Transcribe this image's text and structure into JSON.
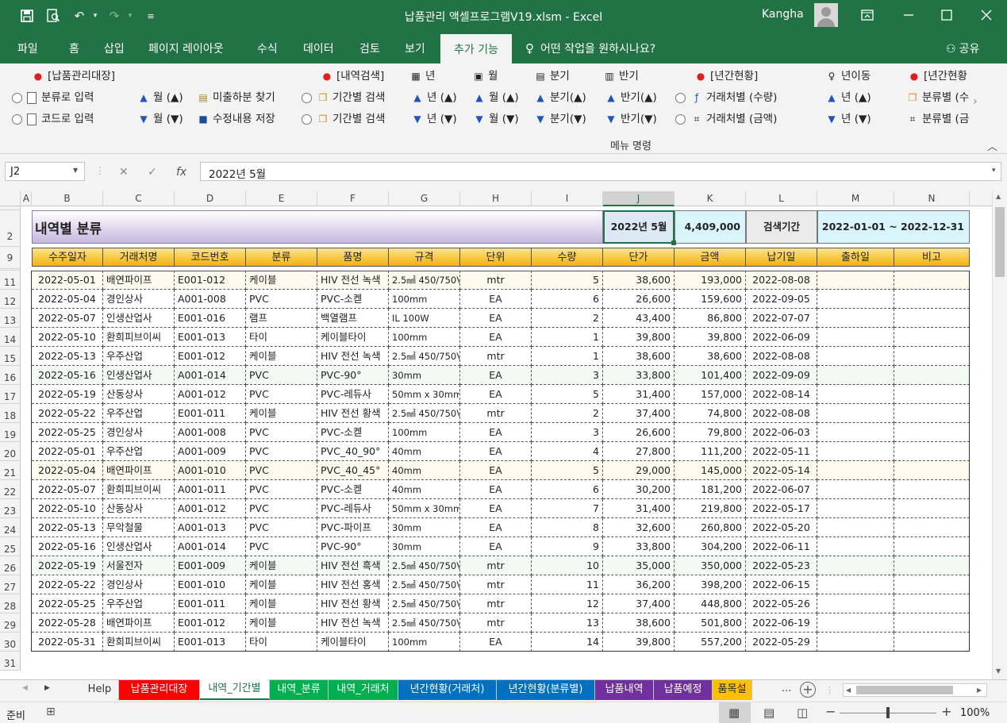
{
  "window": {
    "title": "납품관리 액셀프로그램V19.xlsm  -  Excel",
    "user": "Kangha"
  },
  "ribbon_tabs": [
    "파일",
    "홈",
    "삽입",
    "페이지 레이아웃",
    "수식",
    "데이터",
    "검토",
    "보기"
  ],
  "active_tab": "추가 기능",
  "tell_me": "어떤 작업을 원하시나요?",
  "share": "공유",
  "ribbon": {
    "group_label": "메뉴 명령",
    "headers": {
      "h1": "[납품관리대장]",
      "h2": "[내역검색]",
      "h3": "년",
      "h4": "월",
      "h5": "분기",
      "h6": "반기",
      "h7": "[년간현황]",
      "h8": "년이동",
      "h9": "[년간현황"
    },
    "items": {
      "r1": "분류로 입력",
      "r2": "코드로 입력",
      "m1": "월 (▲)",
      "m2": "월 (▼)",
      "f1": "미출하분 찾기",
      "f2": "수정내용 저장",
      "p1": "기간별 검색",
      "p2": "기간별 검색",
      "y1": "년 (▲)",
      "y2": "년 (▼)",
      "mo1": "월 (▲)",
      "mo2": "월 (▼)",
      "q1": "분기(▲)",
      "q2": "분기(▼)",
      "hy1": "반기(▲)",
      "hy2": "반기(▼)",
      "c1": "거래처별 (수량)",
      "c2": "거래처별 (금액)",
      "ym1": "년 (▲)",
      "ym2": "년 (▼)",
      "cl1": "분류별 (수",
      "cl2": "분류별 (금"
    }
  },
  "formula_bar": {
    "name_box": "J2",
    "formula": "2022년 5월"
  },
  "column_headers": [
    "A",
    "B",
    "C",
    "D",
    "E",
    "F",
    "G",
    "H",
    "I",
    "J",
    "K",
    "L",
    "M",
    "N"
  ],
  "sheet": {
    "title": "내역별 분류",
    "period": "2022년 5월",
    "total": "4,409,000",
    "search_label": "검색기간",
    "range": "2022-01-01 ~ 2022-12-31"
  },
  "table_headers": [
    "수주일자",
    "거래처명",
    "코드번호",
    "분류",
    "품명",
    "규격",
    "단위",
    "수량",
    "단가",
    "금액",
    "납기일",
    "출하일",
    "비고"
  ],
  "row_numbers": [
    "11",
    "12",
    "13",
    "14",
    "15",
    "16",
    "17",
    "18",
    "19",
    "20",
    "21",
    "22",
    "23",
    "24",
    "25",
    "26",
    "27",
    "28",
    "29",
    "30",
    "31"
  ],
  "rows": [
    [
      "2022-05-01",
      "배연파이프",
      "E001-012",
      "케이블",
      "HIV  전선 녹색",
      "2.5㎟ 450/750V",
      "mtr",
      "5",
      "38,600",
      "193,000",
      "2022-08-08",
      "",
      ""
    ],
    [
      "2022-05-04",
      "경인상사",
      "A001-008",
      "PVC",
      "PVC-소켇",
      "100mm",
      "EA",
      "6",
      "26,600",
      "159,600",
      "2022-09-05",
      "",
      ""
    ],
    [
      "2022-05-07",
      "인생산업사",
      "E001-016",
      "램프",
      "백열램프",
      "IL 100W",
      "EA",
      "2",
      "43,400",
      "86,800",
      "2022-07-07",
      "",
      ""
    ],
    [
      "2022-05-10",
      "환희피브이씨",
      "E001-013",
      "타이",
      "케이블타이",
      "100mm",
      "EA",
      "1",
      "39,800",
      "39,800",
      "2022-06-09",
      "",
      ""
    ],
    [
      "2022-05-13",
      "우주산업",
      "E001-012",
      "케이블",
      "HIV  전선 녹색",
      "2.5㎟ 450/750V",
      "mtr",
      "1",
      "38,600",
      "38,600",
      "2022-08-08",
      "",
      ""
    ],
    [
      "2022-05-16",
      "인생산업사",
      "A001-014",
      "PVC",
      "PVC-90°",
      "30mm",
      "EA",
      "3",
      "33,800",
      "101,400",
      "2022-09-09",
      "",
      ""
    ],
    [
      "2022-05-19",
      "산동상사",
      "A001-012",
      "PVC",
      "PVC-레듀사",
      "50mm x 30mm",
      "EA",
      "5",
      "31,400",
      "157,000",
      "2022-08-14",
      "",
      ""
    ],
    [
      "2022-05-22",
      "우주산업",
      "E001-011",
      "케이블",
      "HIV  전선 황색",
      "2.5㎟ 450/750V",
      "mtr",
      "2",
      "37,400",
      "74,800",
      "2022-08-08",
      "",
      ""
    ],
    [
      "2022-05-25",
      "경인상사",
      "A001-008",
      "PVC",
      "PVC-소켇",
      "100mm",
      "EA",
      "3",
      "26,600",
      "79,800",
      "2022-06-03",
      "",
      ""
    ],
    [
      "2022-05-01",
      "우주산업",
      "A001-009",
      "PVC",
      "PVC_40_90°",
      "40mm",
      "EA",
      "4",
      "27,800",
      "111,200",
      "2022-05-11",
      "",
      ""
    ],
    [
      "2022-05-04",
      "배연파이프",
      "A001-010",
      "PVC",
      "PVC_40_45°",
      "40mm",
      "EA",
      "5",
      "29,000",
      "145,000",
      "2022-05-14",
      "",
      ""
    ],
    [
      "2022-05-07",
      "환희피브이씨",
      "A001-011",
      "PVC",
      "PVC-소켇",
      "40mm",
      "EA",
      "6",
      "30,200",
      "181,200",
      "2022-06-07",
      "",
      ""
    ],
    [
      "2022-05-10",
      "산동상사",
      "A001-012",
      "PVC",
      "PVC-레듀사",
      "50mm x 30mm",
      "EA",
      "7",
      "31,400",
      "219,800",
      "2022-05-17",
      "",
      ""
    ],
    [
      "2022-05-13",
      "무악철물",
      "A001-013",
      "PVC",
      "PVC-파이프",
      "30mm",
      "EA",
      "8",
      "32,600",
      "260,800",
      "2022-05-20",
      "",
      ""
    ],
    [
      "2022-05-16",
      "인생산업사",
      "A001-014",
      "PVC",
      "PVC-90°",
      "30mm",
      "EA",
      "9",
      "33,800",
      "304,200",
      "2022-06-11",
      "",
      ""
    ],
    [
      "2022-05-19",
      "서울전자",
      "E001-009",
      "케이블",
      "HIV  전선 흑색",
      "2.5㎟ 450/750V",
      "mtr",
      "10",
      "35,000",
      "350,000",
      "2022-05-23",
      "",
      ""
    ],
    [
      "2022-05-22",
      "경인상사",
      "E001-010",
      "케이블",
      "HIV  전선 홍색",
      "2.5㎟ 450/750V",
      "mtr",
      "11",
      "36,200",
      "398,200",
      "2022-06-15",
      "",
      ""
    ],
    [
      "2022-05-25",
      "우주산업",
      "E001-011",
      "케이블",
      "HIV  전선 황색",
      "2.5㎟ 450/750V",
      "mtr",
      "12",
      "37,400",
      "448,800",
      "2022-05-26",
      "",
      ""
    ],
    [
      "2022-05-28",
      "배연파이프",
      "E001-012",
      "케이블",
      "HIV  전선 녹색",
      "2.5㎟ 450/750V",
      "mtr",
      "13",
      "38,600",
      "501,800",
      "2022-06-19",
      "",
      ""
    ],
    [
      "2022-05-31",
      "환희피브이씨",
      "E001-013",
      "타이",
      "케이블타이",
      "100mm",
      "EA",
      "14",
      "39,800",
      "557,200",
      "2022-05-29",
      "",
      ""
    ]
  ],
  "sheet_tabs": [
    {
      "label": "Help",
      "bg": "#f3f3f3",
      "fg": "#333"
    },
    {
      "label": "납품관리대장",
      "bg": "#ff0000",
      "fg": "#ffffff"
    },
    {
      "label": "내역_기간별",
      "bg": "#ffffff",
      "fg": "#217346"
    },
    {
      "label": "내역_분류",
      "bg": "#00b050",
      "fg": "#ffffff"
    },
    {
      "label": "내역_거래처",
      "bg": "#00b050",
      "fg": "#ffffff"
    },
    {
      "label": "년간현황(거래처)",
      "bg": "#0070c0",
      "fg": "#ffffff"
    },
    {
      "label": "년간현황(분류별)",
      "bg": "#0070c0",
      "fg": "#ffffff"
    },
    {
      "label": "납품내역",
      "bg": "#7030a0",
      "fg": "#ffffff"
    },
    {
      "label": "납품예정",
      "bg": "#7030a0",
      "fg": "#ffffff"
    },
    {
      "label": "품목설",
      "bg": "#ffc000",
      "fg": "#222222"
    }
  ],
  "tab_more": "...",
  "status": {
    "ready": "준비",
    "zoom": "100%"
  }
}
